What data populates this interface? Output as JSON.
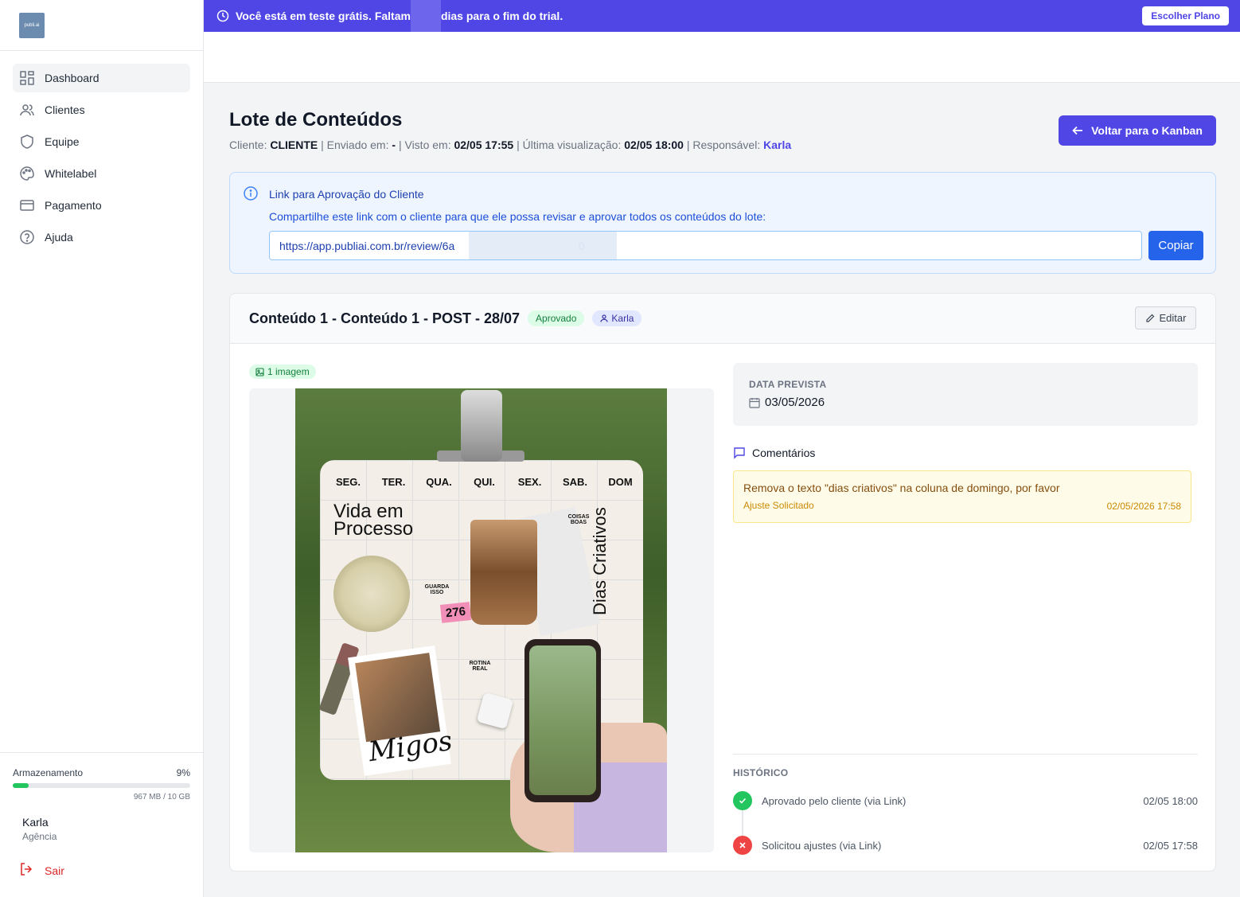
{
  "logo": {
    "text": "publi.ai"
  },
  "sidebar": {
    "items": [
      {
        "label": "Dashboard",
        "icon": "grid-icon"
      },
      {
        "label": "Clientes",
        "icon": "users-icon"
      },
      {
        "label": "Equipe",
        "icon": "shield-icon"
      },
      {
        "label": "Whitelabel",
        "icon": "palette-icon"
      },
      {
        "label": "Pagamento",
        "icon": "credit-card-icon"
      },
      {
        "label": "Ajuda",
        "icon": "help-circle-icon"
      }
    ],
    "storage": {
      "label": "Armazenamento",
      "percent": "9%",
      "percent_value": 0.09,
      "size": "967 MB / 10 GB"
    },
    "user": {
      "name": "Karla",
      "role": "Agência"
    },
    "logout": "Sair"
  },
  "banner": {
    "text_before": "Você está em teste grátis. Faltam",
    "text_after": "dias para o fim do trial.",
    "button": "Escolher Plano",
    "color": "#4f46e5"
  },
  "page": {
    "title": "Lote de Conteúdos",
    "meta": {
      "cliente_label": "Cliente:",
      "cliente": "CLIENTE",
      "enviado_label": "| Enviado em:",
      "enviado": "-",
      "visto_label": "| Visto em:",
      "visto": "02/05 17:55",
      "ultima_label": "| Última visualização:",
      "ultima": "02/05 18:00",
      "resp_label": "| Responsável:",
      "resp": "Karla"
    },
    "back_button": "Voltar para o Kanban"
  },
  "approval_link": {
    "title": "Link para Aprovação do Cliente",
    "description": "Compartilhe este link com o cliente para que ele possa revisar e aprovar todos os conteúdos do lote:",
    "url": "https://app.publiai.com.br/review/6a                                        0",
    "copy_button": "Copiar"
  },
  "content": {
    "title": "Conteúdo 1 - Conteúdo 1 - POST - 28/07",
    "status_badge": "Aprovado",
    "assignee_badge": "Karla",
    "edit_button": "Editar",
    "images_badge": "1 imagem",
    "post": {
      "days": [
        "SEG.",
        "TER.",
        "QUA.",
        "QUI.",
        "SEX.",
        "SAB.",
        "DOM"
      ],
      "title": "Vida em Processo",
      "side_title": "Dias Criativos",
      "tag": "276",
      "script": "Migos",
      "stickers": [
        "COISAS BOAS",
        "GUARDA ISSO",
        "ROTINA REAL"
      ]
    },
    "date": {
      "label": "DATA PREVISTA",
      "value": "03/05/2026"
    },
    "comments": {
      "title": "Comentários",
      "items": [
        {
          "text": "Remova o texto \"dias criativos\" na coluna de domingo, por favor",
          "status": "Ajuste Solicitado",
          "date": "02/05/2026 17:58"
        }
      ]
    },
    "history": {
      "label": "HISTÓRICO",
      "items": [
        {
          "text": "Aprovado pelo cliente (via Link)",
          "date": "02/05 18:00",
          "type": "ok"
        },
        {
          "text": "Solicitou ajustes (via Link)",
          "date": "02/05 17:58",
          "type": "err"
        }
      ]
    }
  }
}
